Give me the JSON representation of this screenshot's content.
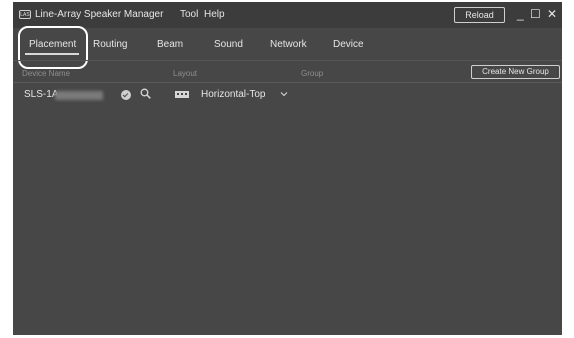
{
  "app": {
    "icon_text": "LAS",
    "title": "Line-Array Speaker Manager",
    "menu": [
      "Tool",
      "Help"
    ],
    "reload_label": "Reload",
    "controls": {
      "minimize": "_",
      "maximize": "☐",
      "close": "✕"
    }
  },
  "tabs": [
    "Placement",
    "Routing",
    "Beam",
    "Sound",
    "Network",
    "Device"
  ],
  "active_tab": "Placement",
  "table": {
    "headers": [
      "Device Name",
      "Layout",
      "Group"
    ],
    "create_group_label": "Create New Group",
    "rows": [
      {
        "device_name": "SLS-1A-",
        "layout": "Horizontal-Top"
      }
    ]
  },
  "icons": [
    "app-icon",
    "check-circle-icon",
    "search-icon",
    "speaker-array-icon",
    "chevron-down-icon"
  ]
}
